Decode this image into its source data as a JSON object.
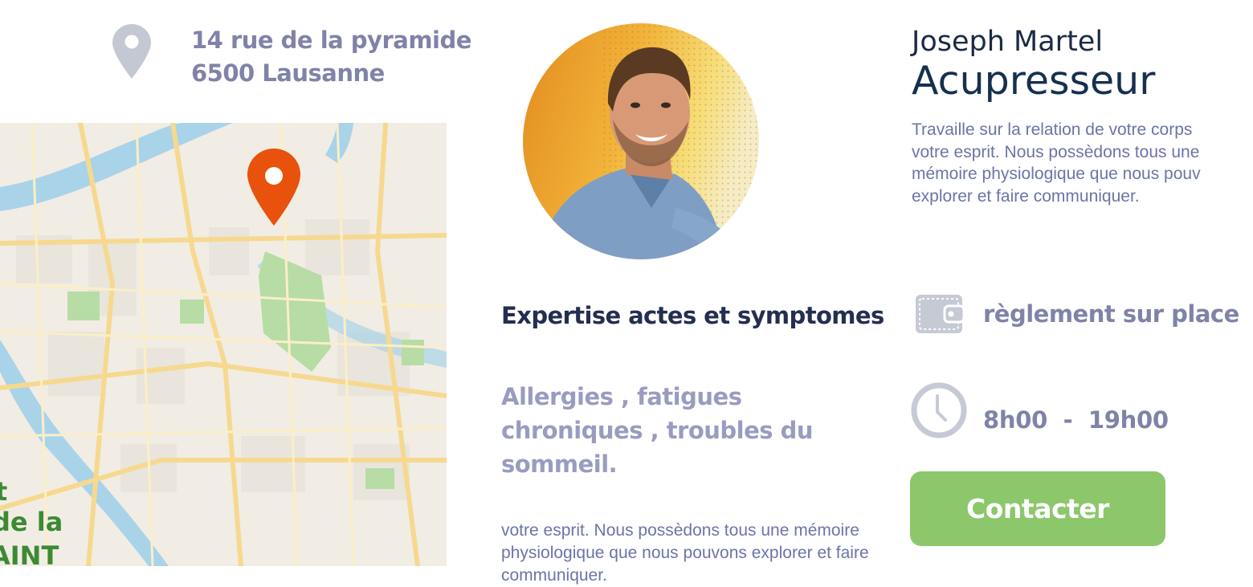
{
  "address": {
    "line1": "14 rue de la pyramide",
    "line2": "6500 Lausanne",
    "icon": "location-pin-icon"
  },
  "map": {
    "marker_icon": "map-marker-icon",
    "marker_color": "#e8520c",
    "label_partial": "t\nde la\nAINT"
  },
  "practitioner": {
    "name": "Joseph Martel",
    "title": "Acupresseur",
    "description": "Travaille sur la relation de votre corps\nvotre esprit. Nous possèdons tous une\nmémoire physiologique que nous pouv\nexplorer et faire communiquer."
  },
  "expertise": {
    "heading": "Expertise actes et symptomes",
    "body": "Allergies , fatigues chroniques , troubles du sommeil.",
    "extra": "votre esprit. Nous possèdons tous une mémoire physiologique que nous pouvons explorer et faire communiquer."
  },
  "payment": {
    "label": "règlement sur place",
    "icon": "wallet-icon"
  },
  "hours": {
    "label": "8h00  -  19h00",
    "icon": "clock-icon"
  },
  "contact": {
    "label": "Contacter",
    "color": "#8cc76b"
  }
}
